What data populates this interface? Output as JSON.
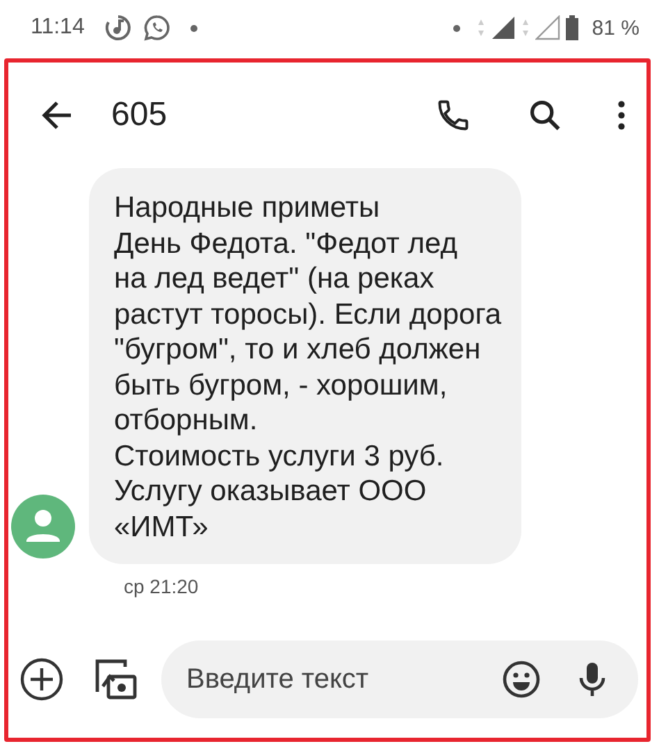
{
  "status_bar": {
    "time": "11:14",
    "battery": "81 %"
  },
  "header": {
    "title": "605"
  },
  "messages": [
    {
      "text": "Народные приметы\nДень Федота. \"Федот лед\nна лед ведет\" (на реках\nрастут торосы). Если дорога\n\"бугром\", то и хлеб должен\nбыть бугром, - хорошим,\nотборным.\nСтоимость услуги 3 руб.\nУслугу оказывает ООО\n«ИМТ»",
      "time": "ср 21:20"
    }
  ],
  "composer": {
    "placeholder": "Введите текст"
  }
}
